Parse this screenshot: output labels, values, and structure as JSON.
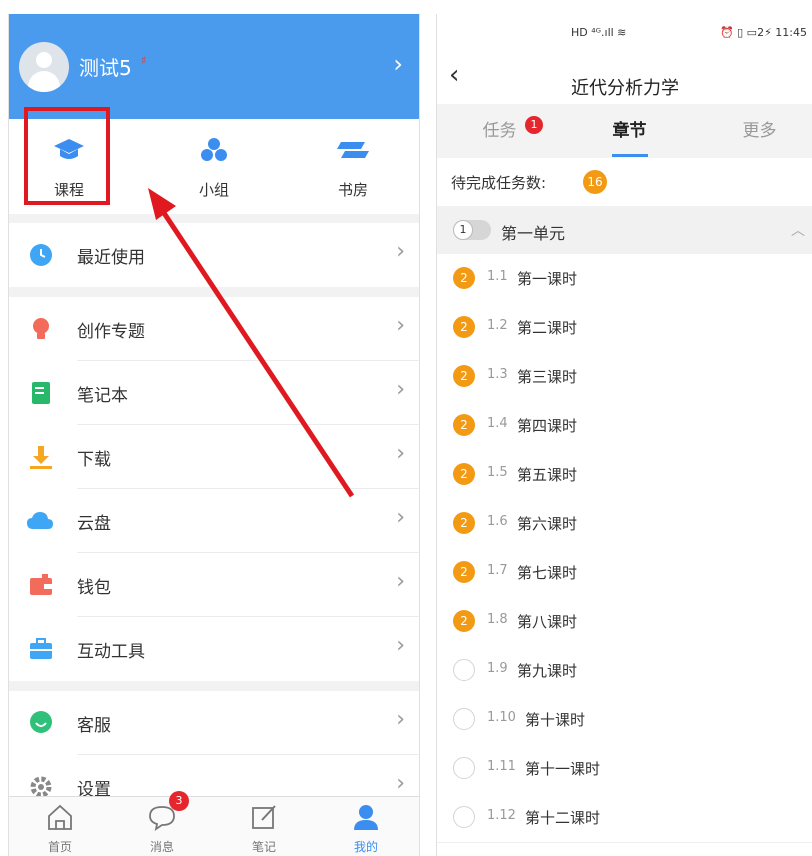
{
  "left": {
    "profile": {
      "name": "测试5",
      "mark": "♯"
    },
    "quick": [
      {
        "label": "课程",
        "icon": "graduation-cap-icon"
      },
      {
        "label": "小组",
        "icon": "group-icon"
      },
      {
        "label": "书房",
        "icon": "book-stack-icon"
      }
    ],
    "menu": [
      {
        "label": "最近使用",
        "icon": "clock-icon",
        "color": "#3ea6f5"
      },
      {
        "label": "创作专题",
        "icon": "lightbulb-icon",
        "color": "#f36b5a"
      },
      {
        "label": "笔记本",
        "icon": "notebook-icon",
        "color": "#27b86a"
      },
      {
        "label": "下载",
        "icon": "download-icon",
        "color": "#f5a623"
      },
      {
        "label": "云盘",
        "icon": "cloud-icon",
        "color": "#3ea6f5"
      },
      {
        "label": "钱包",
        "icon": "wallet-icon",
        "color": "#f36b5a"
      },
      {
        "label": "互动工具",
        "icon": "toolbox-icon",
        "color": "#3ea6f5"
      },
      {
        "label": "客服",
        "icon": "support-icon",
        "color": "#2fc07a"
      },
      {
        "label": "设置",
        "icon": "gear-icon",
        "color": "#888888"
      }
    ],
    "tabbar": [
      {
        "label": "首页",
        "icon": "home-icon"
      },
      {
        "label": "消息",
        "icon": "chat-icon",
        "badge": "3"
      },
      {
        "label": "笔记",
        "icon": "edit-icon"
      },
      {
        "label": "我的",
        "icon": "user-icon"
      }
    ]
  },
  "right": {
    "status": {
      "time": "11:45",
      "left_icons": "HD ⁴ᴳ.ıll ≋",
      "right_icons": "⏰ ▯ ▭2⚡"
    },
    "title": "近代分析力学",
    "tabs": [
      {
        "label": "任务",
        "badge": "1"
      },
      {
        "label": "章节"
      },
      {
        "label": "更多"
      }
    ],
    "pending": {
      "label": "待完成任务数:",
      "count": "16"
    },
    "unit": {
      "num": "1",
      "label": "第一单元",
      "caret": "︿"
    },
    "lessons": [
      {
        "num": "1.1",
        "name": "第一课时",
        "badge": "2"
      },
      {
        "num": "1.2",
        "name": "第二课时",
        "badge": "2"
      },
      {
        "num": "1.3",
        "name": "第三课时",
        "badge": "2"
      },
      {
        "num": "1.4",
        "name": "第四课时",
        "badge": "2"
      },
      {
        "num": "1.5",
        "name": "第五课时",
        "badge": "2"
      },
      {
        "num": "1.6",
        "name": "第六课时",
        "badge": "2"
      },
      {
        "num": "1.7",
        "name": "第七课时",
        "badge": "2"
      },
      {
        "num": "1.8",
        "name": "第八课时",
        "badge": "2"
      },
      {
        "num": "1.9",
        "name": "第九课时",
        "badge": ""
      },
      {
        "num": "1.10",
        "name": "第十课时",
        "badge": ""
      },
      {
        "num": "1.11",
        "name": "第十一课时",
        "badge": ""
      },
      {
        "num": "1.12",
        "name": "第十二课时",
        "badge": ""
      }
    ]
  },
  "colors": {
    "accent": "#3b8ef0",
    "header": "#4a9bee",
    "badge_orange": "#f39a14",
    "badge_red": "#e5262d",
    "highlight": "#e0181f"
  }
}
